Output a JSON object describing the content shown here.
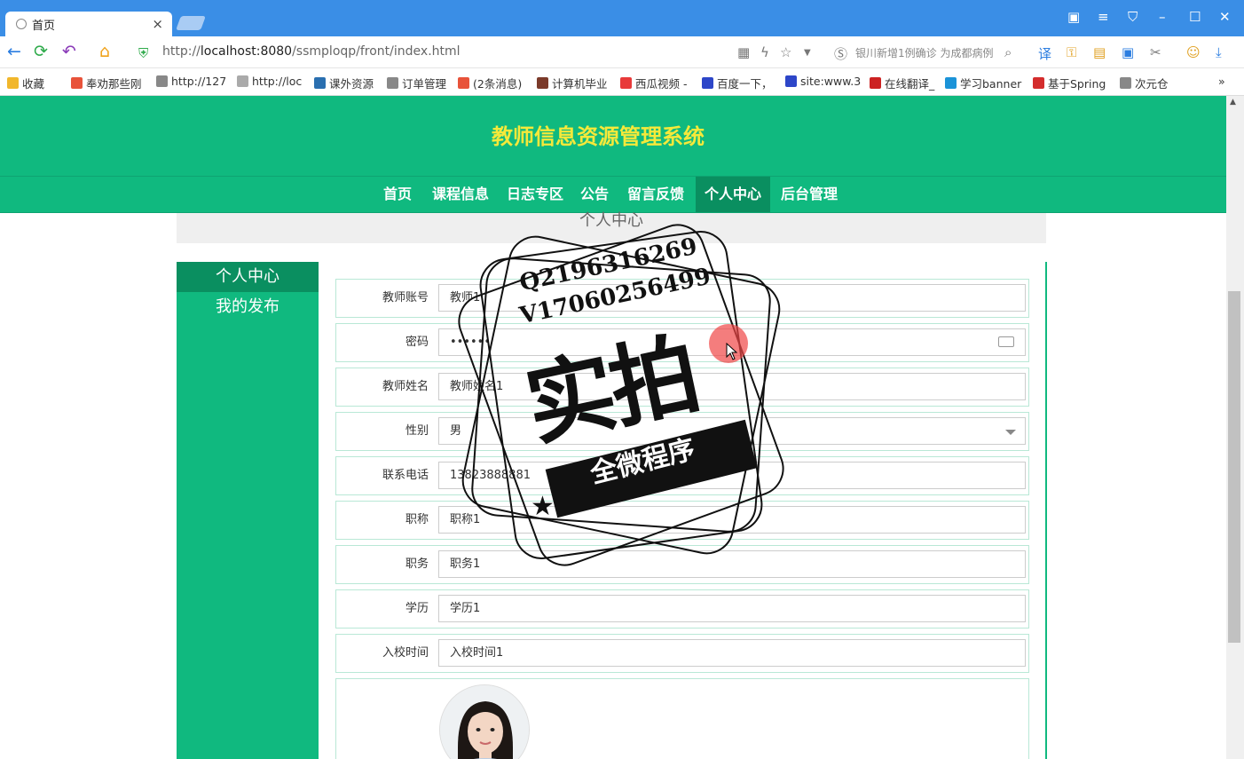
{
  "browser": {
    "tab_title": "首页",
    "tab_close": "×",
    "url_prefix": "http://",
    "url_host": "localhost:8080",
    "url_path": "/ssmploqp/front/index.html",
    "search_suggestion": "银川新增1例确诊 为成都病例"
  },
  "bookmarks": [
    {
      "label": "收藏",
      "icon": "star-icon",
      "color": "#f1b72c"
    },
    {
      "label": "奉劝那些刚",
      "icon": "c-icon",
      "color": "#e8533a"
    },
    {
      "label": "http://127",
      "icon": "page-icon",
      "color": "#888888"
    },
    {
      "label": "http://loc",
      "icon": "shield-icon",
      "color": "#aaaaaa"
    },
    {
      "label": "课外资源",
      "icon": "logo-icon",
      "color": "#2a6fb0"
    },
    {
      "label": "订单管理",
      "icon": "page-icon",
      "color": "#888888"
    },
    {
      "label": "(2条消息)",
      "icon": "c-icon",
      "color": "#e8533a"
    },
    {
      "label": "计算机毕业",
      "icon": "avatar-icon",
      "color": "#7b3a2a"
    },
    {
      "label": "西瓜视频 -",
      "icon": "play-icon",
      "color": "#e83a3a"
    },
    {
      "label": "百度一下，",
      "icon": "paw-icon",
      "color": "#2d46c8"
    },
    {
      "label": "site:www.3",
      "icon": "paw-icon",
      "color": "#2d46c8"
    },
    {
      "label": "在线翻译_",
      "icon": "y-icon",
      "color": "#cc2222"
    },
    {
      "label": "学习banner",
      "icon": "gear-icon",
      "color": "#1b93d8"
    },
    {
      "label": "基于Spring",
      "icon": "g-icon",
      "color": "#d42d2d"
    },
    {
      "label": "次元仓",
      "icon": "page-icon",
      "color": "#888888"
    }
  ],
  "site": {
    "title": "教师信息资源管理系统",
    "nav": [
      "首页",
      "课程信息",
      "日志专区",
      "公告",
      "留言反馈",
      "个人中心",
      "后台管理"
    ],
    "breadcrumb": "个人中心",
    "sidebar": [
      "个人中心",
      "我的发布"
    ]
  },
  "form": [
    {
      "label": "教师账号",
      "value": "教师1"
    },
    {
      "label": "密码",
      "value": "••••••"
    },
    {
      "label": "教师姓名",
      "value": "教师姓名1"
    },
    {
      "label": "性别",
      "value": "男"
    },
    {
      "label": "联系电话",
      "value": "13823888881"
    },
    {
      "label": "职称",
      "value": "职称1"
    },
    {
      "label": "职务",
      "value": "职务1"
    },
    {
      "label": "学历",
      "value": "学历1"
    },
    {
      "label": "入校时间",
      "value": "入校时间1"
    }
  ],
  "watermark": {
    "line1": "Q2196316269",
    "line2": "V17060256499",
    "big": "实拍",
    "band": "全微程序"
  },
  "colors": {
    "primary": "#10b97f",
    "active": "#0a8f60",
    "title": "#f5e93a"
  }
}
